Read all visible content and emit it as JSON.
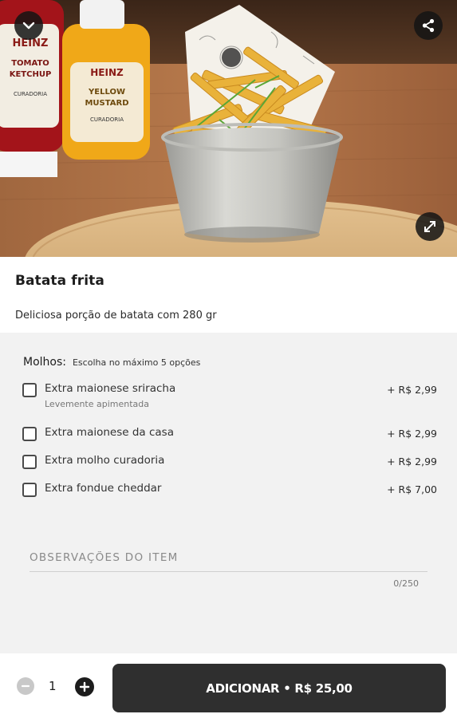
{
  "hero": {
    "image_name": "batata-frita-photo",
    "back_icon": "chevron-down-icon",
    "share_icon": "share-icon",
    "expand_icon": "expand-icon",
    "ketchup_label": [
      "HEINZ",
      "TOMATO",
      "KETCHUP",
      "CURADORIA"
    ],
    "mustard_label": [
      "HEINZ",
      "YELLOW",
      "MUSTARD",
      "CURADORIA"
    ]
  },
  "product": {
    "name": "Batata frita",
    "description": "Deliciosa porção de batata com 280 gr"
  },
  "options_group": {
    "title": "Molhos:",
    "subtitle": "Escolha no máximo 5 opções",
    "items": [
      {
        "label": "Extra maionese sriracha",
        "note": "Levemente apimentada",
        "price": "+ R$ 2,99",
        "checked": false
      },
      {
        "label": "Extra maionese da casa",
        "note": "",
        "price": "+ R$ 2,99",
        "checked": false
      },
      {
        "label": "Extra molho curadoria",
        "note": "",
        "price": "+ R$ 2,99",
        "checked": false
      },
      {
        "label": "Extra fondue cheddar",
        "note": "",
        "price": "+ R$ 7,00",
        "checked": false
      }
    ]
  },
  "notes": {
    "placeholder": "OBSERVAÇÕES DO ITEM",
    "value": "",
    "counter": "0/250"
  },
  "cart": {
    "quantity": "1",
    "minus_icon": "minus-circle-icon",
    "plus_icon": "plus-circle-icon",
    "add_label": "ADICIONAR • R$ 25,00"
  },
  "colors": {
    "button_bg": "#2f2f2f",
    "options_bg": "#f2f2f2"
  }
}
